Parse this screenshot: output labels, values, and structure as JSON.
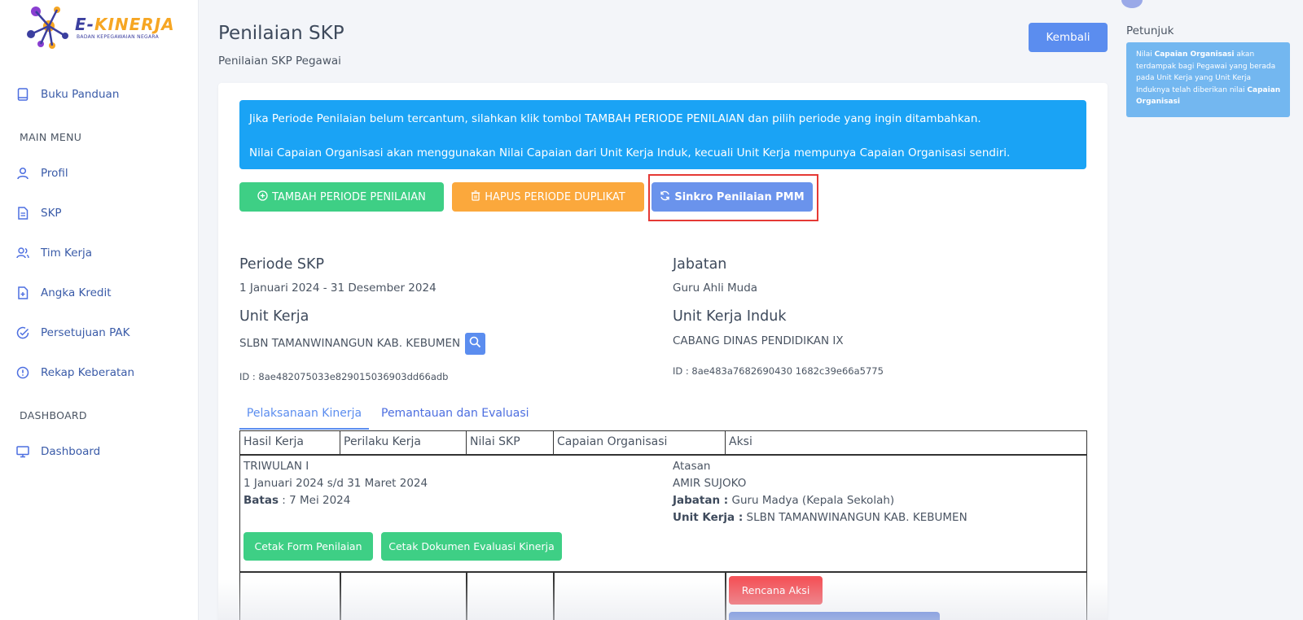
{
  "brand": {
    "name_part1": "E-",
    "name_part2": "KINERJA",
    "subtitle": "BADAN KEPEGAWAIAN NEGARA"
  },
  "sidebar": {
    "top_items": [
      {
        "label": "Buku Panduan",
        "icon": "book-icon"
      }
    ],
    "sections": [
      {
        "title": "MAIN MENU",
        "items": [
          {
            "label": "Profil",
            "icon": "user-icon"
          },
          {
            "label": "SKP",
            "icon": "document-icon"
          },
          {
            "label": "Tim Kerja",
            "icon": "users-icon"
          },
          {
            "label": "Angka Kredit",
            "icon": "file-plus-icon"
          },
          {
            "label": "Persetujuan PAK",
            "icon": "check-circle-icon"
          },
          {
            "label": "Rekap Keberatan",
            "icon": "alert-circle-icon"
          }
        ]
      },
      {
        "title": "DASHBOARD",
        "items": [
          {
            "label": "Dashboard",
            "icon": "monitor-icon"
          }
        ]
      }
    ]
  },
  "header": {
    "title": "Penilaian SKP",
    "subtitle": "Penilaian SKP Pegawai",
    "back_label": "Kembali"
  },
  "petunjuk": {
    "title": "Petunjuk",
    "text_1": "Nilai ",
    "bold_1": "Capaian Organisasi",
    "text_2": " akan terdampak bagi Pegawai yang berada pada Unit Kerja yang Unit Kerja Induknya telah diberikan nilai ",
    "bold_2": "Capaian Organisasi"
  },
  "info": {
    "line1": "Jika Periode Penilaian belum tercantum, silahkan klik tombol TAMBAH PERIODE PENILAIAN dan pilih periode yang ingin ditambahkan.",
    "line2": "Nilai Capaian Organisasi akan menggunakan Nilai Capaian dari Unit Kerja Induk, kecuali Unit Kerja mempunya Capaian Organisasi sendiri."
  },
  "actions": {
    "tambah": "TAMBAH PERIODE PENILAIAN",
    "hapus": "HAPUS PERIODE DUPLIKAT",
    "sinkro": "Sinkro Penilaian PMM"
  },
  "detail": {
    "periode_label": "Periode SKP",
    "periode_value": "1 Januari 2024 - 31 Desember 2024",
    "jabatan_label": "Jabatan",
    "jabatan_value": "Guru Ahli Muda",
    "unit_label": "Unit Kerja",
    "unit_value": "SLBN TAMANWINANGUN KAB. KEBUMEN",
    "unit_id": "ID : 8ae482075033e829015036903dd66adb",
    "induk_label": "Unit Kerja Induk",
    "induk_value": "CABANG DINAS PENDIDIKAN IX",
    "induk_id": "ID : 8ae483a7682690430 1682c39e66a5775"
  },
  "tabs": [
    {
      "label": "Pelaksanaan Kinerja"
    },
    {
      "label": "Pemantauan dan Evaluasi"
    }
  ],
  "table": {
    "headers": [
      "Hasil Kerja",
      "Perilaku Kerja",
      "Nilai SKP",
      "Capaian Organisasi",
      "Aksi"
    ],
    "period": {
      "name": "TRIWULAN I",
      "range": "1 Januari 2024 s/d 31 Maret 2024",
      "batas_label": "Batas",
      "batas_value": " : 7 Mei 2024",
      "atasan_label": "Atasan",
      "atasan_name": "AMIR SUJOKO",
      "jabatan_label": "Jabatan :",
      "jabatan_value": " Guru Madya (Kepala Sekolah)",
      "unit_label": "Unit Kerja :",
      "unit_value": " SLBN TAMANWINANGUN KAB. KEBUMEN",
      "btn_cetak_form": "Cetak Form Penilaian",
      "btn_cetak_dok": "Cetak Dokumen Evaluasi Kinerja"
    },
    "row_action": "Rencana Aksi"
  }
}
